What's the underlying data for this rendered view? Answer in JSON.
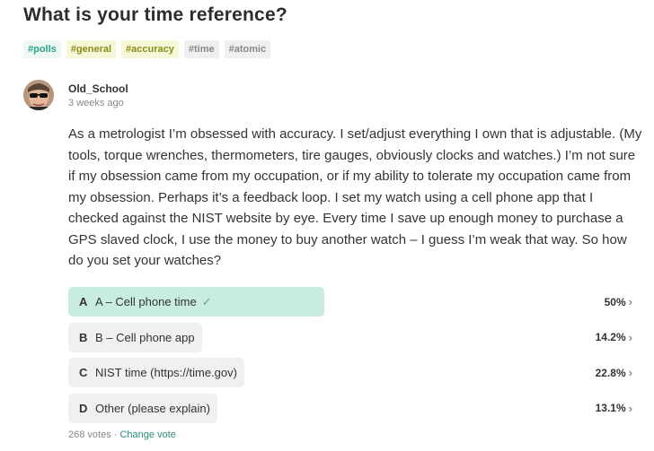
{
  "post": {
    "title": "What is your time reference?",
    "tags": [
      {
        "label": "#polls",
        "bg": "#eef9f6",
        "color": "#2aa385"
      },
      {
        "label": "#general",
        "bg": "#f6f8d8",
        "color": "#8a8d1a"
      },
      {
        "label": "#accuracy",
        "bg": "#f6f8d8",
        "color": "#8a8d1a"
      },
      {
        "label": "#time",
        "bg": "#f0f0f0",
        "color": "#888888"
      },
      {
        "label": "#atomic",
        "bg": "#f0f0f0",
        "color": "#888888"
      }
    ],
    "author": {
      "name": "Old_School",
      "time": "3 weeks ago"
    },
    "body": "As a metrologist I’m obsessed with accuracy. I set/adjust everything I own that is adjustable. (My tools, torque wrenches, thermometers, tire gauges, obviously clocks and watches.) I’m not sure if my obsession came from my occupation, or if my ability to tolerate my occupation came from my obsession. Perhaps it’s a feedback loop. I set my watch using a cell phone app that I checked against the NIST website by eye. Every time I save up enough money to purchase a GPS slaved clock, I use the money to buy another watch – I guess I’m weak that way. So how do you set your watches?"
  },
  "poll": {
    "options": [
      {
        "letter": "A",
        "label": "A – Cell phone time",
        "percent_text": "50%",
        "percent": 0.5,
        "selected": true,
        "fill": "#c8ecdf"
      },
      {
        "letter": "B",
        "label": "B – Cell phone app",
        "percent_text": "14.2%",
        "percent": 0.142,
        "selected": false,
        "fill": "#f0f0f0"
      },
      {
        "letter": "C",
        "label": "NIST time (https://time.gov)",
        "percent_text": "22.8%",
        "percent": 0.228,
        "selected": false,
        "fill": "#f0f0f0"
      },
      {
        "letter": "D",
        "label": "Other (please explain)",
        "percent_text": "13.1%",
        "percent": 0.131,
        "selected": false,
        "fill": "#f0f0f0"
      }
    ],
    "votes_text": "268 votes",
    "separator": " · ",
    "change_vote": "Change vote",
    "check_glyph": "✓",
    "chevron_glyph": "›"
  }
}
